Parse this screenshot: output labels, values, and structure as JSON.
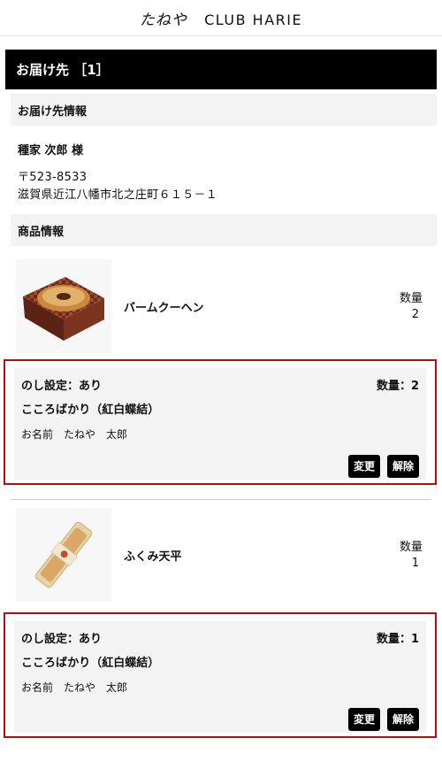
{
  "header": {
    "logo_script": "たねや",
    "logo_brand": "CLUB HARIE"
  },
  "destination": {
    "title": "お届け先 ［1］",
    "info_heading": "お届け先情報",
    "recipient_name": "種家 次郎 様",
    "postal": "〒523-8533",
    "address": "滋賀県近江八幡市北之庄町６１５－１",
    "products_heading": "商品情報"
  },
  "products": [
    {
      "name": "バームクーヘン",
      "qty_label": "数量",
      "qty_value": "2",
      "noshi": {
        "setting": "のし設定：あり",
        "qty": "数量：2",
        "type": "こころばかり（紅白蝶結）",
        "name_line": "お名前　たねや　太郎",
        "change_label": "変更",
        "remove_label": "解除"
      }
    },
    {
      "name": "ふくみ天平",
      "qty_label": "数量",
      "qty_value": "1",
      "noshi": {
        "setting": "のし設定：あり",
        "qty": "数量：1",
        "type": "こころばかり（紅白蝶結）",
        "name_line": "お名前　たねや　太郎",
        "change_label": "変更",
        "remove_label": "解除"
      }
    }
  ],
  "colors": {
    "highlight_border": "#b40d0d",
    "bar_bg": "#000000",
    "section_bg": "#f3f3f3"
  }
}
